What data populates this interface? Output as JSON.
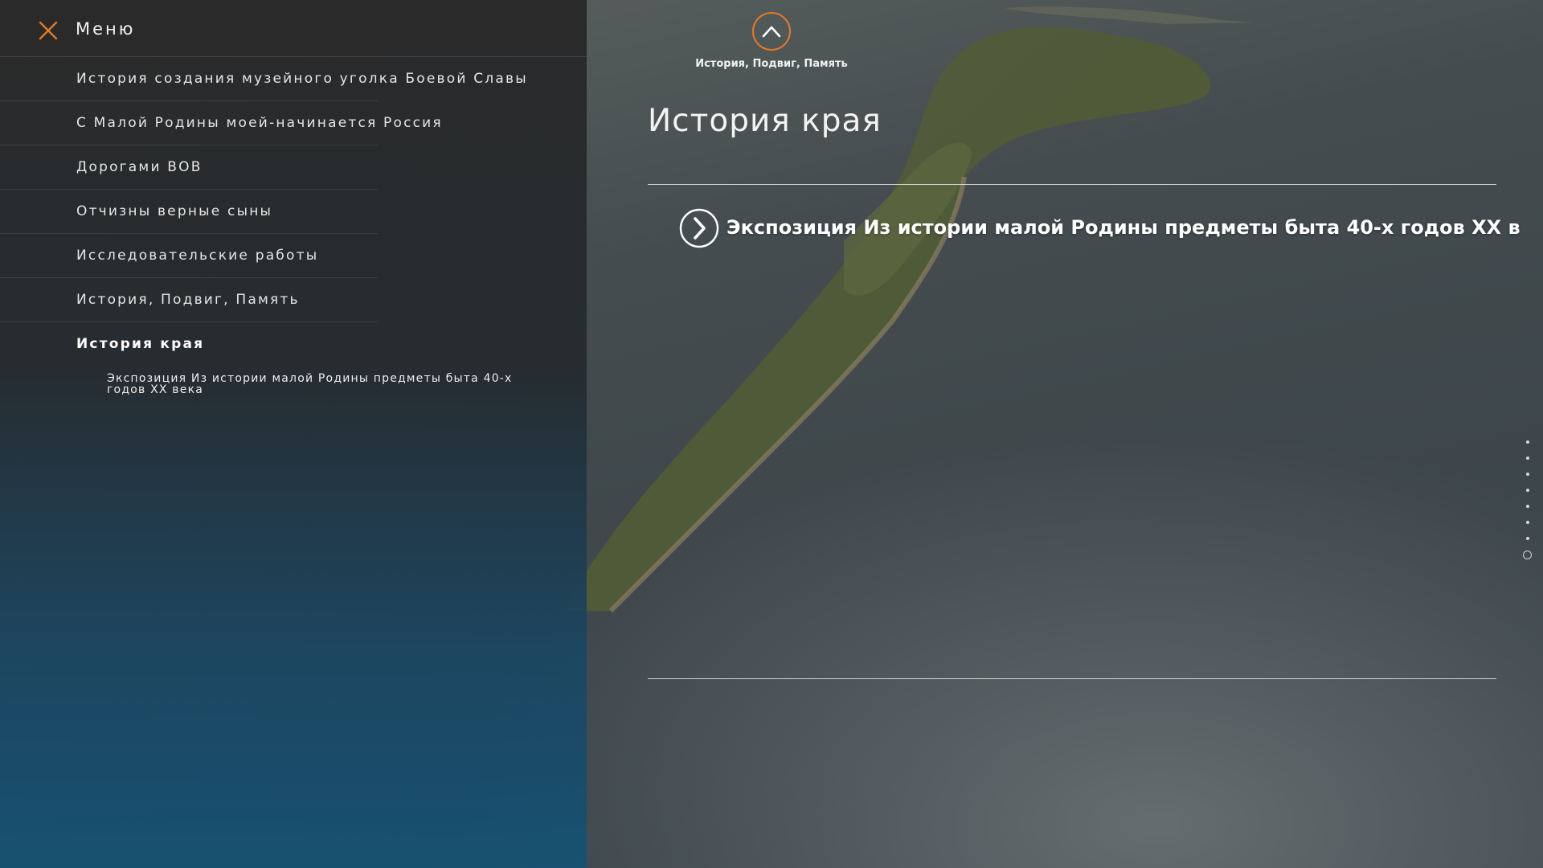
{
  "menu": {
    "title": "Меню",
    "close_icon": "close-x-icon",
    "accent_color": "#e07a2a",
    "items": [
      {
        "label": "История создания музейного уголка Боевой Славы",
        "active": false
      },
      {
        "label": "С Малой Родины моей-начинается Россия",
        "active": false
      },
      {
        "label": "Дорогами ВОВ",
        "active": false
      },
      {
        "label": "Отчизны верные сыны",
        "active": false
      },
      {
        "label": "Исследовательские работы",
        "active": false
      },
      {
        "label": "История, Подвиг, Память",
        "active": false
      },
      {
        "label": "История края",
        "active": true
      }
    ],
    "subitem": {
      "label": "Экспозиция Из истории малой Родины предметы быта 40-х годов XX века"
    }
  },
  "nav": {
    "up_icon": "chevron-up-icon",
    "up_label": "История, Подвиг, Память"
  },
  "main": {
    "title": "История края",
    "link_icon": "chevron-right-circle-icon",
    "link_text": "Экспозиция Из истории малой Родины предметы быта 40-х годов XX в"
  },
  "pagination": {
    "total": 8,
    "current_index": 7
  }
}
